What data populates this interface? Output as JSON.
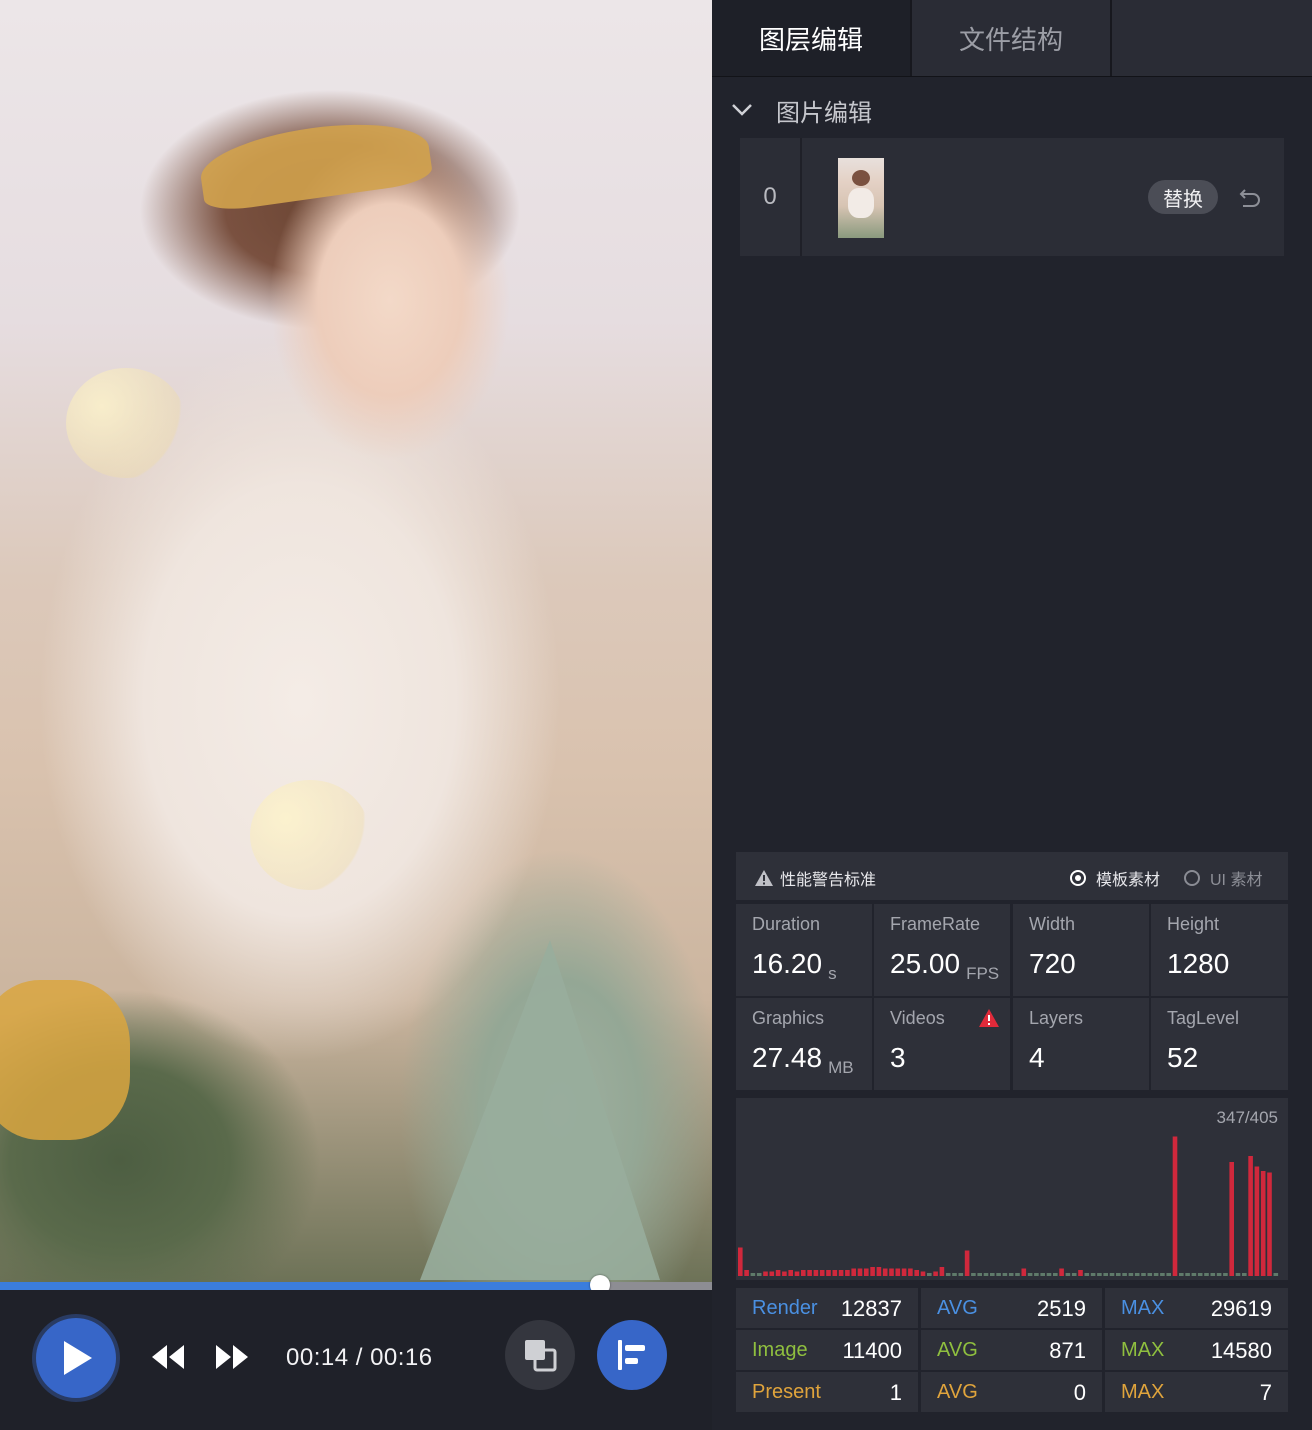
{
  "player": {
    "time_display": "00:14 / 00:16",
    "progress_fraction": 0.843,
    "accent": "#3766c8"
  },
  "panel": {
    "tabs": [
      {
        "label": "图层编辑",
        "active": true
      },
      {
        "label": "文件结构",
        "active": false
      }
    ],
    "section_title": "图片编辑",
    "layer": {
      "index": "0",
      "replace_label": "替换"
    }
  },
  "stats": {
    "warning_title": "性能警告标准",
    "options": [
      {
        "label": "模板素材",
        "selected": true
      },
      {
        "label": "UI 素材",
        "selected": false
      }
    ],
    "metrics": [
      {
        "label": "Duration",
        "value": "16.20",
        "unit": "s"
      },
      {
        "label": "FrameRate",
        "value": "25.00",
        "unit": "FPS"
      },
      {
        "label": "Width",
        "value": "720",
        "unit": ""
      },
      {
        "label": "Height",
        "value": "1280",
        "unit": ""
      },
      {
        "label": "Graphics",
        "value": "27.48",
        "unit": "MB"
      },
      {
        "label": "Videos",
        "value": "3",
        "unit": "",
        "warning": true
      },
      {
        "label": "Layers",
        "value": "4",
        "unit": ""
      },
      {
        "label": "TagLevel",
        "value": "52",
        "unit": ""
      }
    ],
    "frame_chart": {
      "counter": "347/405",
      "bar_color": "#d0283c",
      "bars": [
        0.19,
        0.04,
        0.02,
        0.02,
        0.03,
        0.03,
        0.04,
        0.03,
        0.04,
        0.03,
        0.04,
        0.04,
        0.04,
        0.04,
        0.04,
        0.04,
        0.04,
        0.04,
        0.05,
        0.05,
        0.05,
        0.06,
        0.06,
        0.05,
        0.05,
        0.05,
        0.05,
        0.05,
        0.04,
        0.03,
        0.02,
        0.03,
        0.06,
        0.02,
        0.02,
        0.02,
        0.17,
        0.02,
        0.02,
        0.02,
        0.02,
        0.02,
        0.02,
        0.02,
        0.02,
        0.05,
        0.02,
        0.02,
        0.02,
        0.02,
        0.02,
        0.05,
        0.02,
        0.02,
        0.04,
        0.02,
        0.02,
        0.02,
        0.02,
        0.02,
        0.02,
        0.02,
        0.02,
        0.02,
        0.02,
        0.02,
        0.02,
        0.02,
        0.02,
        0.93,
        0.02,
        0.02,
        0.02,
        0.02,
        0.02,
        0.02,
        0.02,
        0.02,
        0.76,
        0.02,
        0.02,
        0.8,
        0.73,
        0.7,
        0.69,
        0.02
      ]
    },
    "perf": [
      {
        "name": "Render",
        "value": "12837",
        "avg_label": "AVG",
        "avg": "2519",
        "max_label": "MAX",
        "max": "29619",
        "color": "#4a90e2"
      },
      {
        "name": "Image",
        "value": "11400",
        "avg_label": "AVG",
        "avg": "871",
        "max_label": "MAX",
        "max": "14580",
        "color": "#8fbf3f"
      },
      {
        "name": "Present",
        "value": "1",
        "avg_label": "AVG",
        "avg": "0",
        "max_label": "MAX",
        "max": "7",
        "color": "#e0a43c"
      }
    ]
  }
}
